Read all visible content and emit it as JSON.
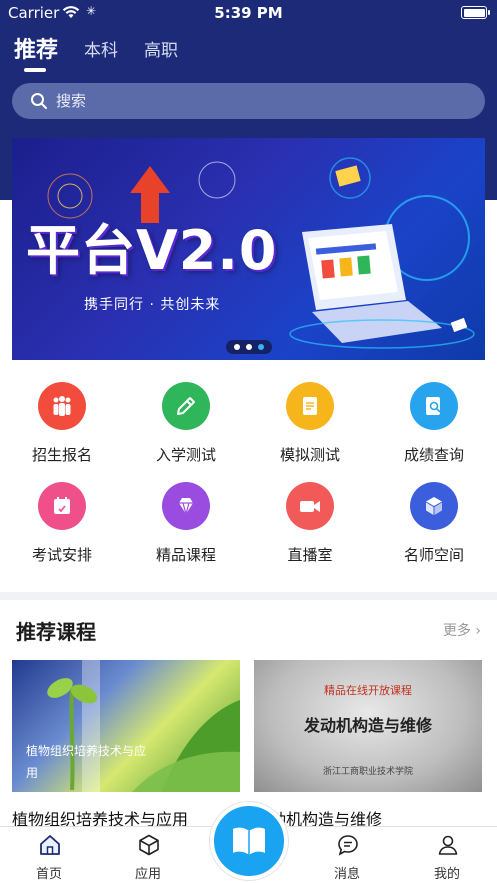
{
  "status": {
    "carrier": "Carrier",
    "time": "5:39 PM"
  },
  "tabs": [
    {
      "label": "推荐",
      "active": true
    },
    {
      "label": "本科",
      "active": false
    },
    {
      "label": "高职",
      "active": false
    }
  ],
  "search": {
    "placeholder": "搜索"
  },
  "banner": {
    "title": "平台V2.0",
    "subtitle": "携手同行 · 共创未来",
    "dots": 3,
    "active_dot": 3
  },
  "grid": [
    {
      "label": "招生报名",
      "icon": "people-icon",
      "color": "#f24c3d"
    },
    {
      "label": "入学测试",
      "icon": "pencil-icon",
      "color": "#2fb65a"
    },
    {
      "label": "模拟测试",
      "icon": "document-icon",
      "color": "#f7b51c"
    },
    {
      "label": "成绩查询",
      "icon": "search-document-icon",
      "color": "#28a3ee"
    },
    {
      "label": "考试安排",
      "icon": "calendar-icon",
      "color": "#f0508a"
    },
    {
      "label": "精品课程",
      "icon": "diamond-icon",
      "color": "#9a4ce0"
    },
    {
      "label": "直播室",
      "icon": "video-camera-icon",
      "color": "#f25a5a"
    },
    {
      "label": "名师空间",
      "icon": "cube-icon",
      "color": "#3b5fdc"
    }
  ],
  "section": {
    "title": "推荐课程",
    "more": "更多"
  },
  "courses": [
    {
      "name": "植物组织培养技术与应用",
      "overlay": "植物组织培养技术与应用"
    },
    {
      "name": "动机构造与维修",
      "banner_top": "精品在线开放课程",
      "banner_title": "发动机构造与维修",
      "banner_bottom": "浙江工商职业技术学院"
    }
  ],
  "tabbar": [
    {
      "label": "首页",
      "icon": "home-icon"
    },
    {
      "label": "应用",
      "icon": "cube-icon"
    },
    {
      "label": "消息",
      "icon": "message-icon"
    },
    {
      "label": "我的",
      "icon": "user-icon"
    }
  ],
  "colors": {
    "header": "#1d2a78",
    "accent": "#1aa3f0"
  }
}
